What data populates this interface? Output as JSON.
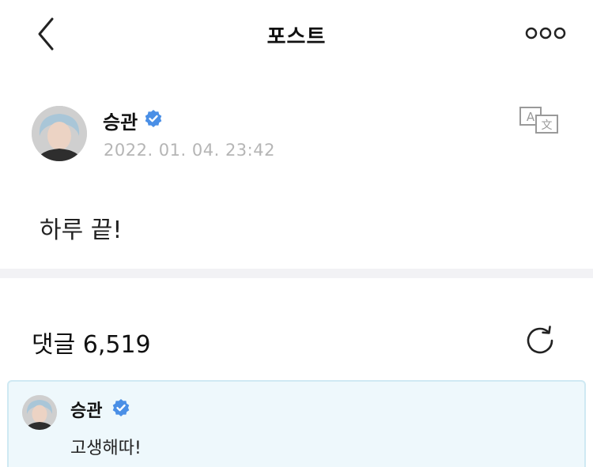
{
  "header": {
    "title": "포스트",
    "back_icon": "chevron-left-icon",
    "more_icon": "more-horizontal-icon"
  },
  "post": {
    "author": "승관",
    "verified_icon": "verified-badge-icon",
    "timestamp": "2022. 01. 04. 23:42",
    "translate_icon": "translate-icon",
    "body": "하루 끝!"
  },
  "comments": {
    "count_label": "댓글 6,519",
    "refresh_icon": "refresh-icon",
    "items": [
      {
        "author": "승관",
        "text": "고생해따!"
      }
    ]
  },
  "colors": {
    "verified": "#4a8fe6",
    "timestamp": "#b5b5b5",
    "divider": "#f2f2f5",
    "comment_bg": "#eef8fc",
    "comment_border": "#cfe9f3"
  }
}
